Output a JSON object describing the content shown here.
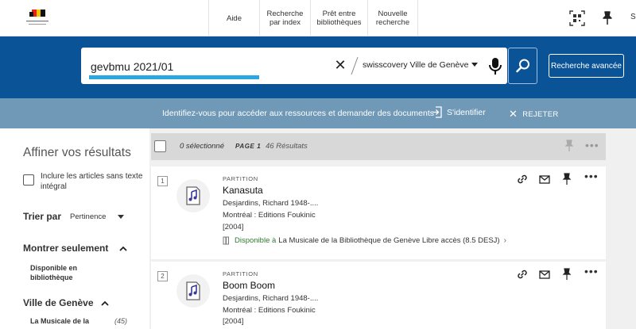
{
  "header": {
    "nav": [
      "Aide",
      "Recherche\npar index",
      "Prêt entre\nbibliothèques",
      "Nouvelle\nrecherche"
    ],
    "cut_text": "S"
  },
  "search": {
    "query": "gevbmu 2021/01",
    "scope": "swisscovery Ville de Genève",
    "advanced_label": "Recherche avancée",
    "clear_icon": "close-icon",
    "mic_icon": "microphone-icon",
    "search_icon": "search-icon"
  },
  "signin_bar": {
    "message": "Identifiez-vous pour accéder aux ressources et demander des documents",
    "signin_label": "S'identifier",
    "reject_label": "REJETER"
  },
  "facets": {
    "title": "Affiner vos résultats",
    "include_articles_label": "Inclure les articles sans texte intégral",
    "sort_label": "Trier par",
    "sort_value": "Pertinence",
    "show_only_label": "Montrer seulement",
    "show_only_item": "Disponible en bibliothèque",
    "ville_label": "Ville de Genève",
    "ville_item": "La Musicale de la",
    "ville_item_count": "(45)"
  },
  "results_header": {
    "selected": "0 sélectionné",
    "page": "PAGE 1",
    "count": "46 Résultats"
  },
  "results": [
    {
      "rank": "1",
      "type": "PARTITION",
      "title": "Kanasuta",
      "author": "Desjardins, Richard 1948-....",
      "publisher": "Montréal : Editions Foukinic",
      "date": "[2004]",
      "availability": "Disponible à",
      "location": "La Musicale de la Bibliothèque de Genève  Libre accès (8.5 DESJ)"
    },
    {
      "rank": "2",
      "type": "PARTITION",
      "title": "Boom Boom",
      "author": "Desjardins, Richard 1948-....",
      "publisher": "Montréal : Editions Foukinic",
      "date": "[2004]"
    }
  ],
  "colors": {
    "brand_blue": "#0a5396",
    "signin_band": "#6f99b7",
    "available_green": "#2f7a2f",
    "query_highlight": "#2aa7e0"
  }
}
